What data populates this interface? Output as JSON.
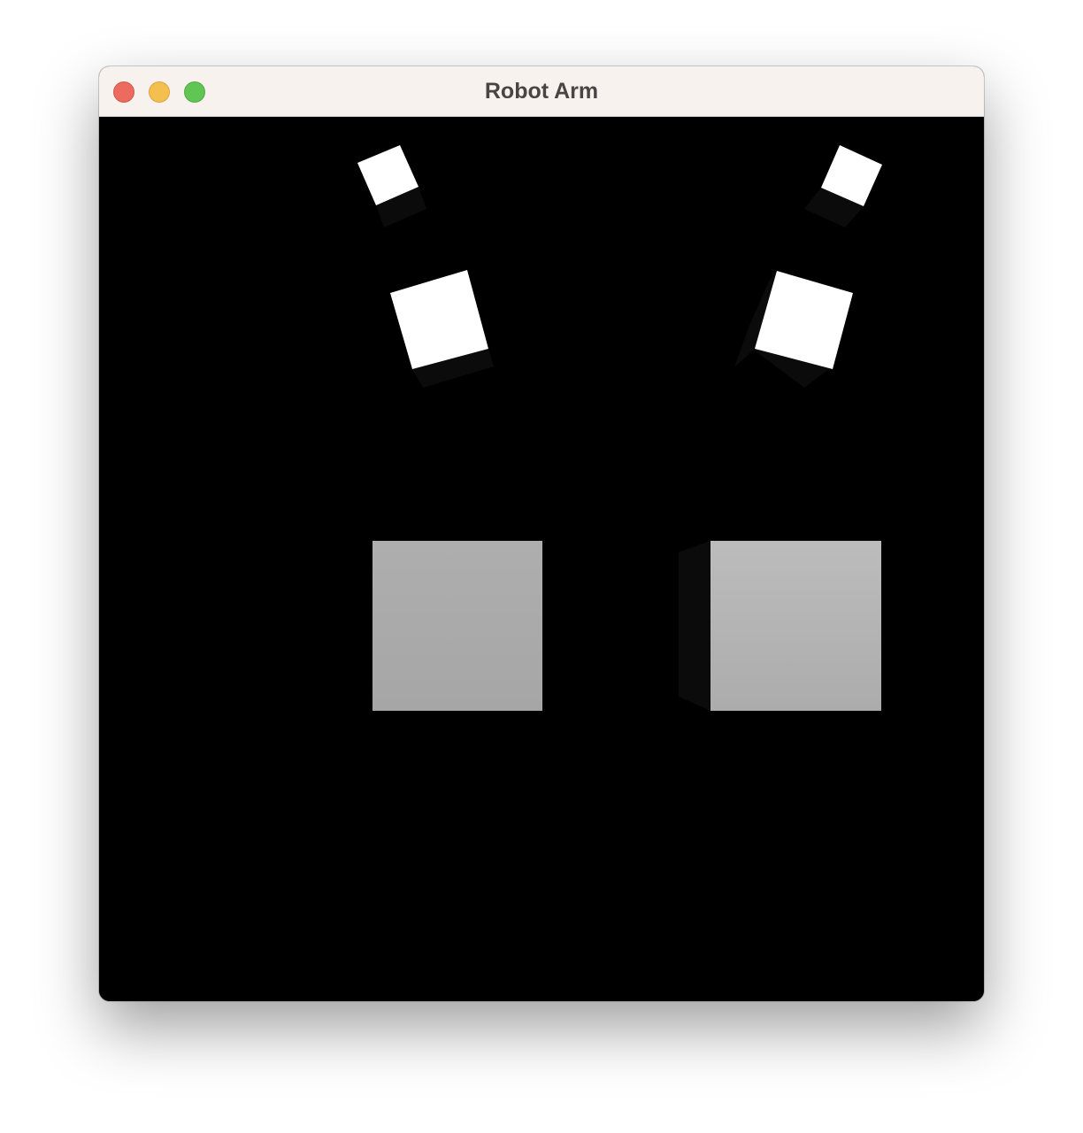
{
  "window": {
    "title": "Robot Arm",
    "controls": {
      "close": "close-icon",
      "minimize": "minimize-icon",
      "zoom": "zoom-icon"
    }
  },
  "scene": {
    "background_color": "#000000",
    "cube_face_color": "#ffffff",
    "cube_shadow_color": "#0b0b0b",
    "base_gradient_left": [
      "#aeaeae",
      "#a6a6a6"
    ],
    "base_gradient_right": [
      "#bcbcbc",
      "#acacac"
    ]
  }
}
